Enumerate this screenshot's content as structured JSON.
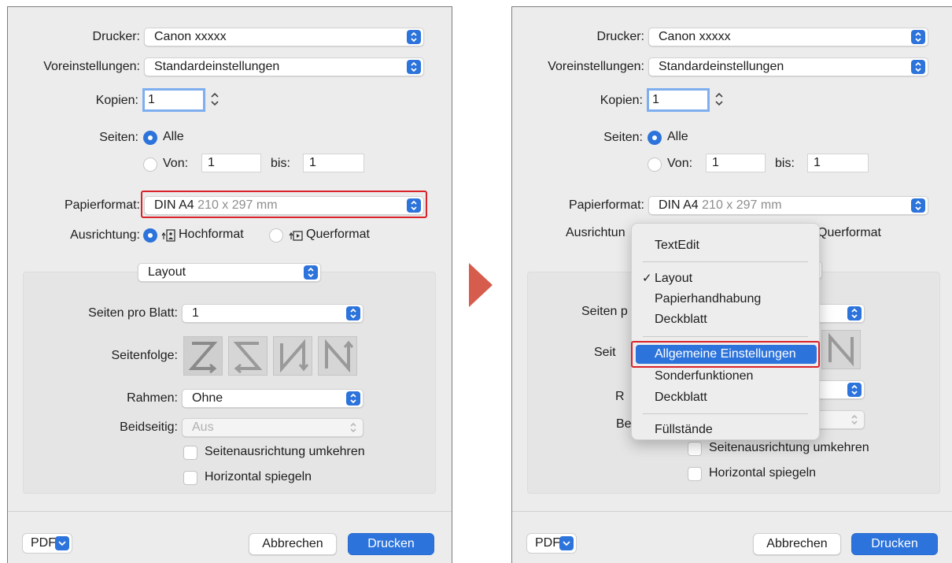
{
  "dialog": {
    "printer_label": "Drucker:",
    "printer_value": "Canon xxxxx",
    "presets_label": "Voreinstellungen:",
    "presets_value": "Standardeinstellungen",
    "copies_label": "Kopien:",
    "copies_value": "1",
    "pages_label": "Seiten:",
    "pages_all": "Alle",
    "pages_from_label": "Von:",
    "pages_from_value": "1",
    "pages_to_label": "bis:",
    "pages_to_value": "1",
    "paper_label": "Papierformat:",
    "paper_value": "DIN A4",
    "paper_size": "210 x 297 mm",
    "orientation_label": "Ausrichtung:",
    "orientation_portrait": "Hochformat",
    "orientation_landscape": "Querformat",
    "section_value": "Layout",
    "pages_per_sheet_label": "Seiten pro Blatt:",
    "pages_per_sheet_value": "1",
    "page_order_label": "Seitenfolge:",
    "border_label": "Rahmen:",
    "border_value": "Ohne",
    "twosided_label": "Beidseitig:",
    "twosided_value": "Aus",
    "reverse_orientation_label": "Seitenausrichtung umkehren",
    "flip_horizontal_label": "Horizontal spiegeln",
    "pdf_label": "PDF",
    "cancel_label": "Abbrechen",
    "print_label": "Drucken"
  },
  "right_partial": {
    "orientation_label_cut": "Ausrichtun",
    "pages_per_sheet_cut": "Seiten p",
    "page_order_cut": "Seit",
    "border_cut": "R",
    "twosided_cut": "Be"
  },
  "menu": {
    "items": [
      {
        "label": "TextEdit"
      },
      {
        "label": "Layout",
        "checked": true,
        "check_mark": "✓"
      },
      {
        "label": "Papierhandhabung"
      },
      {
        "label": "Deckblatt"
      },
      {
        "label": "Allgemeine Einstellungen",
        "selected": true
      },
      {
        "label": "Sonderfunktionen"
      },
      {
        "label": "Deckblatt"
      },
      {
        "label": "Füllstände"
      }
    ]
  },
  "colors": {
    "accent": "#2c73db",
    "highlight": "#d9222a",
    "arrow": "#d65d4d"
  }
}
